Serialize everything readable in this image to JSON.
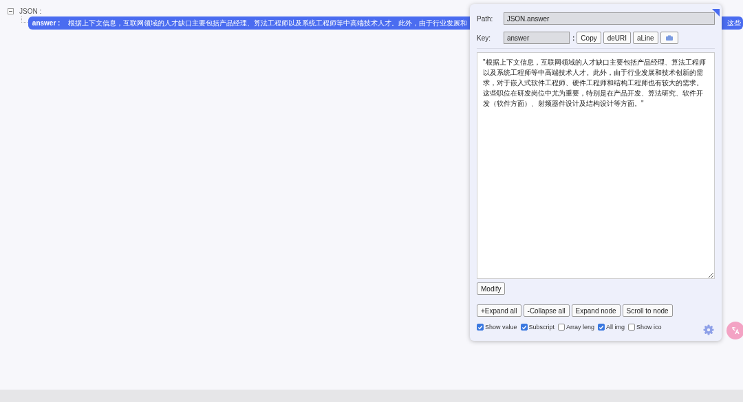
{
  "tree": {
    "root": {
      "label": "JSON :",
      "expanded": true,
      "children": [
        {
          "key": "answer :",
          "value_visible": "根据上下文信息，互联网领域的人才缺口主要包括产品经理、算法工程师以及系统工程师等中高端技术人才。此外，由于行业发展和",
          "value_tail": "这些",
          "selected": true
        }
      ]
    }
  },
  "panel": {
    "path_label": "Path:",
    "path_value": "JSON.answer",
    "key_label": "Key:",
    "key_value": "answer",
    "colon": ":",
    "key_buttons": [
      "Copy",
      "deURI",
      "aLine"
    ],
    "value_text": "\"根据上下文信息，互联网领域的人才缺口主要包括产品经理、算法工程师以及系统工程师等中高端技术人才。此外，由于行业发展和技术创新的需求，对于嵌入式软件工程师、硬件工程师和结构工程师也有较大的需求。这些职位在研发岗位中尤为重要，特别是在产品开发、算法研究、软件开发（软件方面）、射频器件设计及结构设计等方面。\"",
    "modify_button": "Modify",
    "action_buttons": [
      "+Expand all",
      "-Collapse all",
      "Expand node",
      "Scroll to node"
    ],
    "options": [
      {
        "label": "Show value",
        "checked": true
      },
      {
        "label": "Subscript",
        "checked": true
      },
      {
        "label": "Array leng",
        "checked": false
      },
      {
        "label": "All img",
        "checked": true
      },
      {
        "label": "Show ico",
        "checked": false
      }
    ]
  }
}
